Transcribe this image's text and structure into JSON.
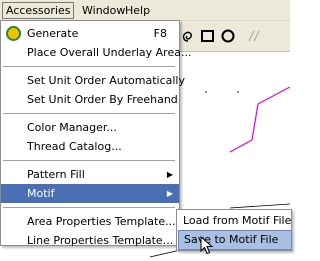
{
  "menubar": {
    "items": [
      {
        "label": "Accessories"
      },
      {
        "label": "Window"
      },
      {
        "label": "Help"
      }
    ]
  },
  "menu": {
    "items": [
      {
        "label": "Generate",
        "accel": "F8"
      },
      {
        "label": "Place Overall Underlay Area..."
      },
      {
        "label": "Set Unit Order Automatically"
      },
      {
        "label": "Set Unit Order By Freehand"
      },
      {
        "label": "Color Manager..."
      },
      {
        "label": "Thread Catalog..."
      },
      {
        "label": "Pattern Fill"
      },
      {
        "label": "Motif"
      },
      {
        "label": "Area Properties Template..."
      },
      {
        "label": "Line Properties Template..."
      }
    ]
  },
  "submenu": {
    "items": [
      {
        "label": "Load from Motif File"
      },
      {
        "label": "Save to Motif File"
      }
    ]
  },
  "colors": {
    "menu_highlight": "#4a6fb5",
    "submenu_highlight": "#a9bfe3",
    "canvas_line_magenta": "#e000e0",
    "generate_icon": "#f0c000"
  },
  "icons": [
    "generate-icon",
    "toolbar-shape-icons",
    "pointer-cursor"
  ]
}
